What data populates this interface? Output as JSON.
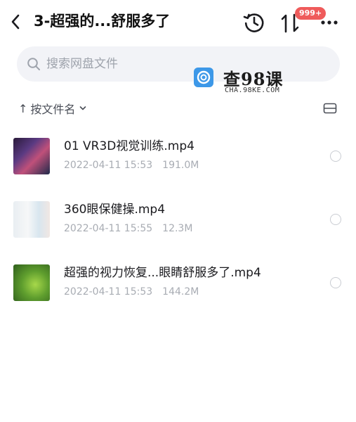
{
  "header": {
    "title": "3-超强的...舒服多了",
    "badge": "999+"
  },
  "search": {
    "placeholder": "搜索网盘文件"
  },
  "watermark": {
    "text": "查98课",
    "sub": "CHA.98KE.COM"
  },
  "sort": {
    "arrow": "↑",
    "label": "按文件名"
  },
  "files": [
    {
      "name": "01 VR3D视觉训练.mp4",
      "date": "2022-04-11 15:53",
      "size": "191.0M"
    },
    {
      "name": "360眼保健操.mp4",
      "date": "2022-04-11 15:55",
      "size": "12.3M"
    },
    {
      "name": "超强的视力恢复...眼睛舒服多了.mp4",
      "date": "2022-04-11 15:53",
      "size": "144.2M"
    }
  ],
  "colors": {
    "accent": "#3d98e8",
    "badge": "#ef5b5b",
    "meta_text": "#a8acb3"
  },
  "icons": {
    "back": "chevron-left",
    "history": "history-clock",
    "sort": "sort-arrows",
    "more": "more-dots",
    "search": "magnifier",
    "view": "list-view"
  }
}
